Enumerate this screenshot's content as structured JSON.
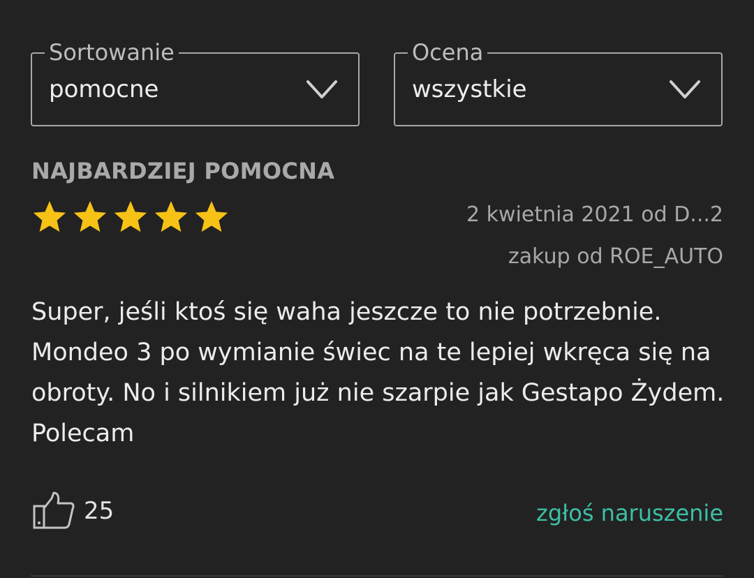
{
  "filters": {
    "sort": {
      "label": "Sortowanie",
      "value": "pomocne"
    },
    "rating": {
      "label": "Ocena",
      "value": "wszystkie"
    }
  },
  "section_title": "NAJBARDZIEJ POMOCNA",
  "review": {
    "stars": 5,
    "star_color": "#f6c216",
    "date_author": "2 kwietnia 2021 od D...2",
    "seller": "zakup od ROE_AUTO",
    "text": "Super, jeśli ktoś się waha jeszcze to nie potrzebnie. Mondeo 3 po wymianie świec na te lepiej wkręca się na obroty. No i silnikiem już nie szarpie jak Gestapo Żydem. Polecam",
    "helpful_count": "25",
    "report_label": "zgłoś naruszenie"
  },
  "colors": {
    "background": "#222222",
    "accent_link": "#3dbfa6",
    "muted_text": "#a8a8a8"
  },
  "icons": {
    "dropdown": "chevron-down-icon",
    "star": "star-icon",
    "helpful": "thumbs-up-icon"
  }
}
